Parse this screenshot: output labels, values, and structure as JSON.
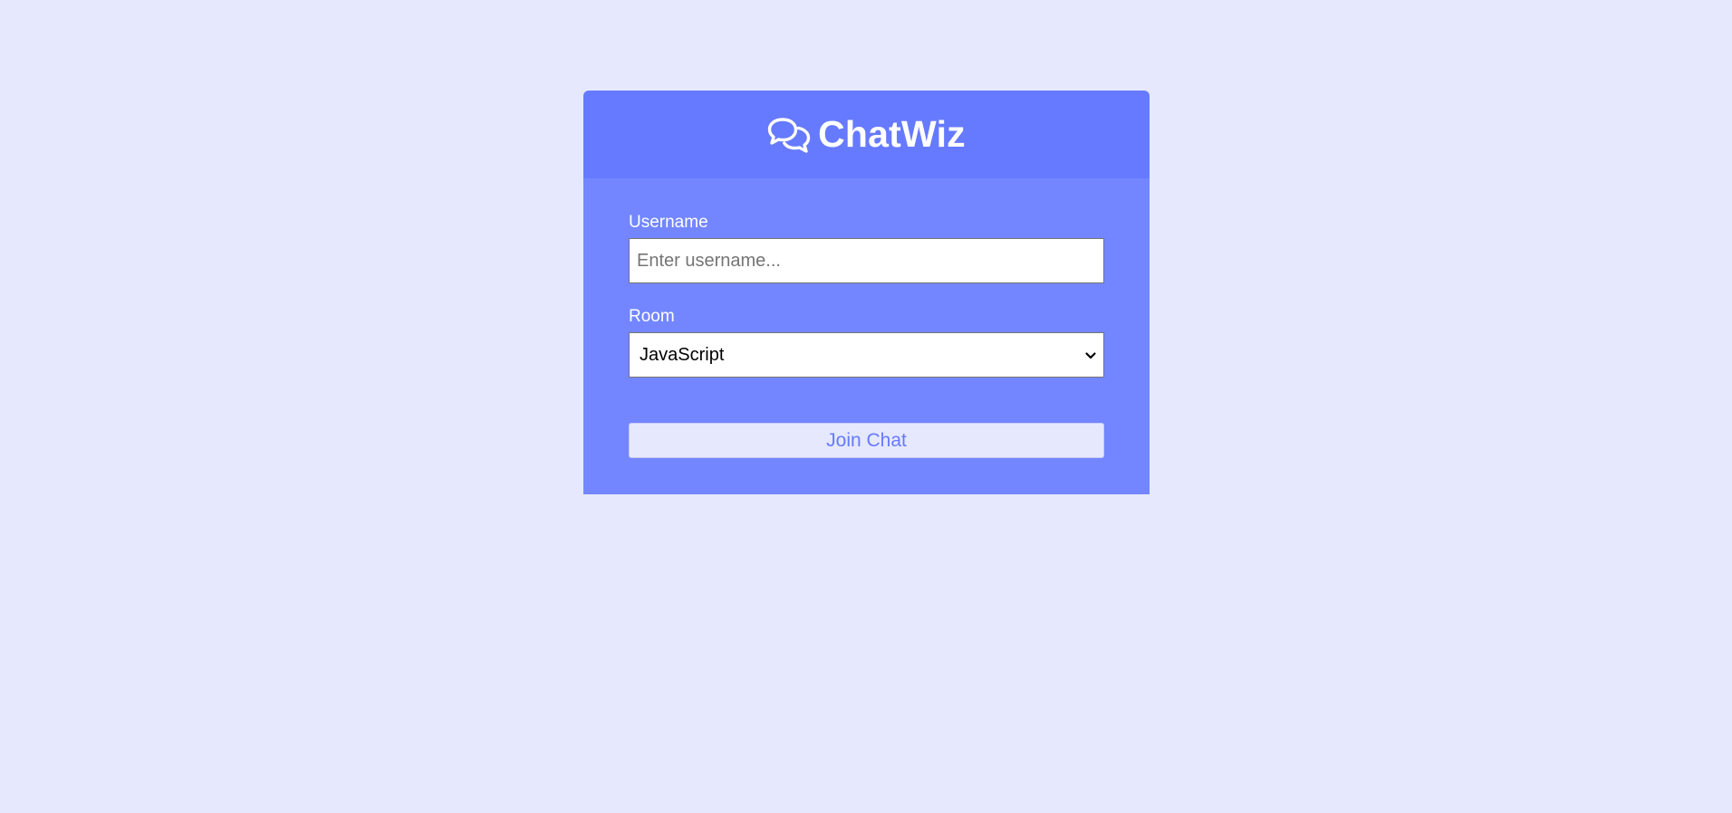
{
  "header": {
    "title": "ChatWiz",
    "icon": "comments-icon"
  },
  "form": {
    "username_label": "Username",
    "username_placeholder": "Enter username...",
    "username_value": "",
    "room_label": "Room",
    "room_selected": "JavaScript",
    "join_label": "Join Chat"
  },
  "colors": {
    "page_background": "#e6e8fe",
    "header_background": "#667aff",
    "body_background": "#7386ff",
    "button_text": "#667aff"
  }
}
